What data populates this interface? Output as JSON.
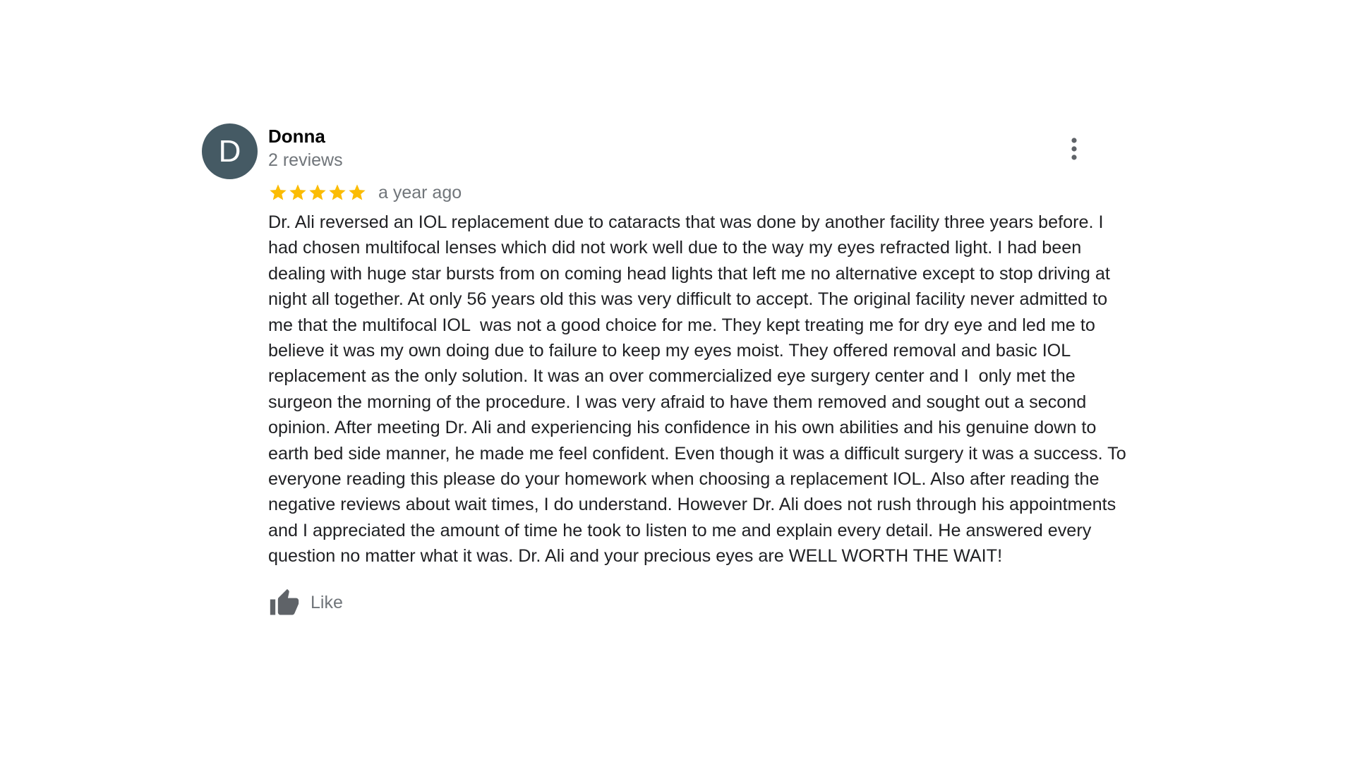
{
  "review": {
    "author": {
      "initial": "D",
      "name": "Donna",
      "review_count": "2 reviews"
    },
    "rating": 5,
    "rating_max": 5,
    "time_ago": "a year ago",
    "text": "Dr. Ali reversed an IOL replacement due to cataracts that was done by another facility three years before. I had chosen multifocal lenses which did not work well due to the way my eyes refracted light. I had been dealing with huge star bursts from on coming head lights that left me no alternative except to stop driving at night all together. At only 56 years old this was very difficult to accept. The original facility never admitted to me that the multifocal IOL  was not a good choice for me. They kept treating me for dry eye and led me to believe it was my own doing due to failure to keep my eyes moist. They offered removal and basic IOL replacement as the only solution. It was an over commercialized eye surgery center and I  only met the surgeon the morning of the procedure. I was very afraid to have them removed and sought out a second opinion. After meeting Dr. Ali and experiencing his confidence in his own abilities and his genuine down to earth bed side manner, he made me feel confident. Even though it was a difficult surgery it was a success. To everyone reading this please do your homework when choosing a replacement IOL. Also after reading the negative reviews about wait times, I do understand. However Dr. Ali does not rush through his appointments and I appreciated the amount of time he took to listen to me and explain every detail. He answered every question no matter what it was. Dr. Ali and your precious eyes are WELL WORTH THE WAIT!",
    "like_label": "Like"
  },
  "icons": {
    "star": "star-icon",
    "like": "thumbs-up-icon",
    "menu": "more-vert-icon"
  },
  "colors": {
    "avatar_bg": "#455a64",
    "star": "#fbbc04",
    "muted_text": "#70757a",
    "icon_gray": "#5f6368"
  }
}
